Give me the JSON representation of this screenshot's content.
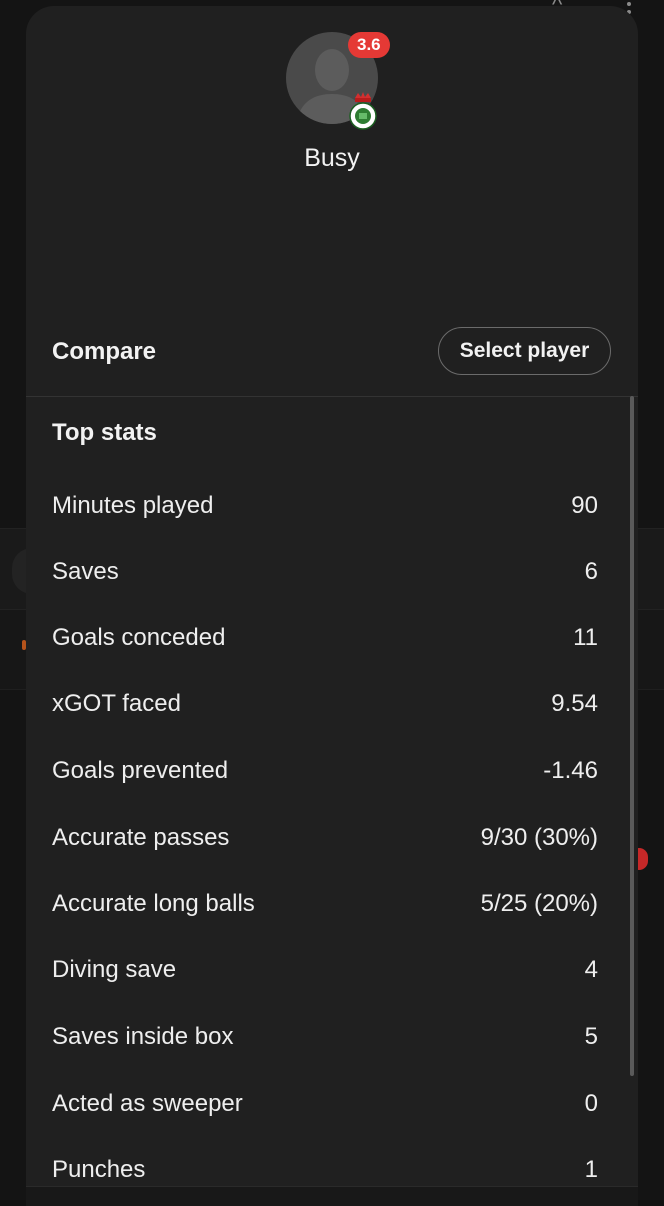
{
  "player": {
    "name": "Busy",
    "rating": "3.6"
  },
  "compare": {
    "label": "Compare",
    "select_button": "Select player"
  },
  "top_stats": {
    "title": "Top stats",
    "rows": [
      {
        "label": "Minutes played",
        "value": "90"
      },
      {
        "label": "Saves",
        "value": "6"
      },
      {
        "label": "Goals conceded",
        "value": "11"
      },
      {
        "label": "xGOT faced",
        "value": "9.54"
      },
      {
        "label": "Goals prevented",
        "value": "-1.46"
      },
      {
        "label": "Accurate passes",
        "value": "9/30 (30%)"
      },
      {
        "label": "Accurate long balls",
        "value": "5/25 (20%)"
      },
      {
        "label": "Diving save",
        "value": "4"
      },
      {
        "label": "Saves inside box",
        "value": "5"
      },
      {
        "label": "Acted as sweeper",
        "value": "0"
      },
      {
        "label": "Punches",
        "value": "1"
      }
    ]
  },
  "colors": {
    "rating_badge": "#e53935",
    "sheet_background": "#202020"
  }
}
